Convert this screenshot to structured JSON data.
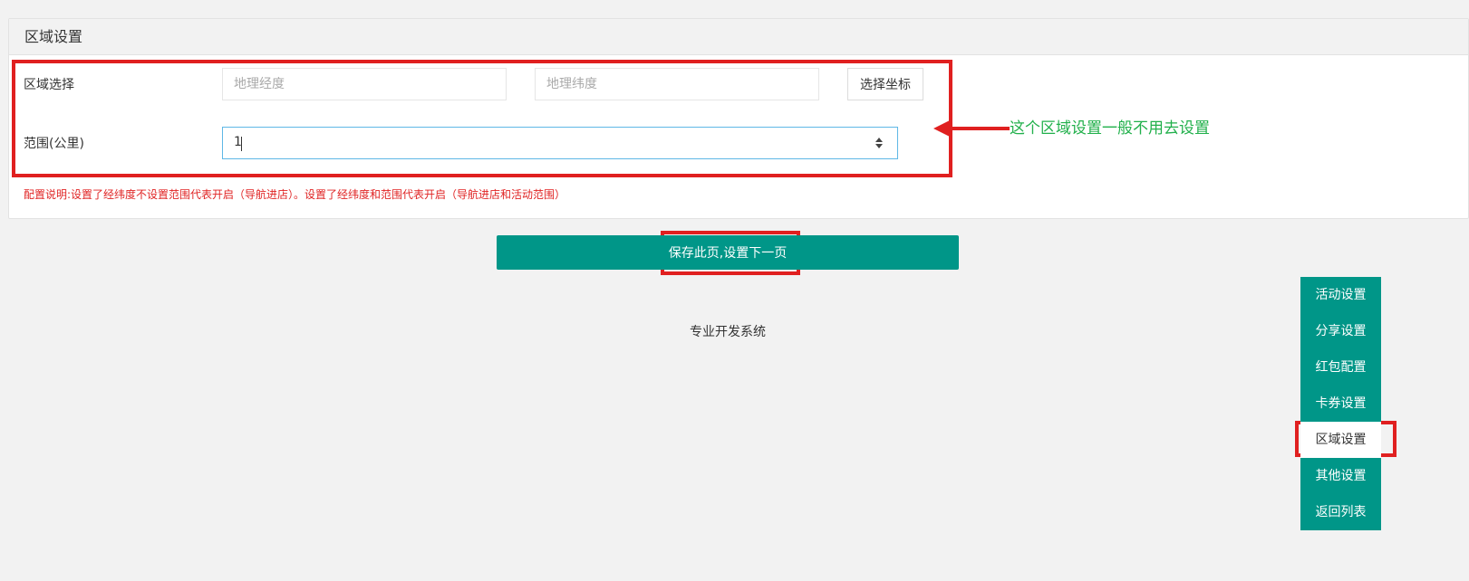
{
  "panel": {
    "title": "区域设置"
  },
  "form": {
    "region_label": "区域选择",
    "longitude_placeholder": "地理经度",
    "latitude_placeholder": "地理纬度",
    "pick_coords_label": "选择坐标",
    "range_label": "范围(公里)",
    "range_value": "1",
    "note": "配置说明:设置了经纬度不设置范围代表开启（导航进店）。设置了经纬度和范围代表开启（导航进店和活动范围）"
  },
  "annotation": {
    "text": "这个区域设置一般不用去设置",
    "color": "#21b04b"
  },
  "save_button_label": "保存此页,设置下一页",
  "footer_text": "专业开发系统",
  "sidenav": {
    "items": [
      {
        "label": "活动设置"
      },
      {
        "label": "分享设置"
      },
      {
        "label": "红包配置"
      },
      {
        "label": "卡券设置"
      },
      {
        "label": "区域设置",
        "active": true
      },
      {
        "label": "其他设置"
      },
      {
        "label": "返回列表"
      }
    ]
  },
  "colors": {
    "accent": "#009688",
    "highlight_border": "#e02020",
    "note_text": "#e02424"
  },
  "icons": {
    "spinner": "up-down-spinner-icon",
    "arrow": "left-arrow-icon"
  }
}
